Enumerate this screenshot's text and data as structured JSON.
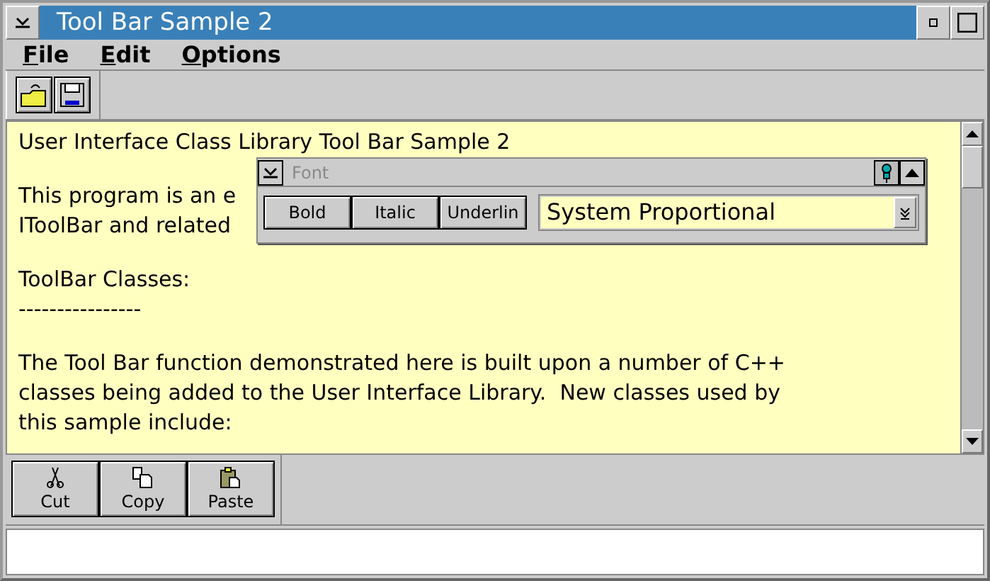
{
  "window": {
    "title": "Tool Bar Sample 2"
  },
  "menu": [
    {
      "label": "File"
    },
    {
      "label": "Edit"
    },
    {
      "label": "Options"
    }
  ],
  "top_toolbar": {
    "buttons": [
      {
        "kind": "open"
      },
      {
        "kind": "save"
      }
    ]
  },
  "editor": {
    "paragraphs": [
      [
        "User Interface Class Library Tool Bar Sample 2"
      ],
      [
        "This program is an e",
        "IToolBar and related"
      ],
      [
        "ToolBar Classes:",
        "----------------"
      ],
      [
        "The Tool Bar function demonstrated here is built upon a number of C++",
        "classes being added to the User Interface Library.  New classes used by",
        "this sample include:"
      ]
    ]
  },
  "font_window": {
    "title": "Font",
    "active": false,
    "buttons": [
      "Bold",
      "Italic",
      "Underlin"
    ],
    "combo": {
      "value": "System Proportional"
    }
  },
  "bottom_toolbar": {
    "buttons": [
      {
        "kind": "cut",
        "label": "Cut"
      },
      {
        "kind": "copy",
        "label": "Copy"
      },
      {
        "kind": "paste",
        "label": "Paste"
      }
    ]
  }
}
